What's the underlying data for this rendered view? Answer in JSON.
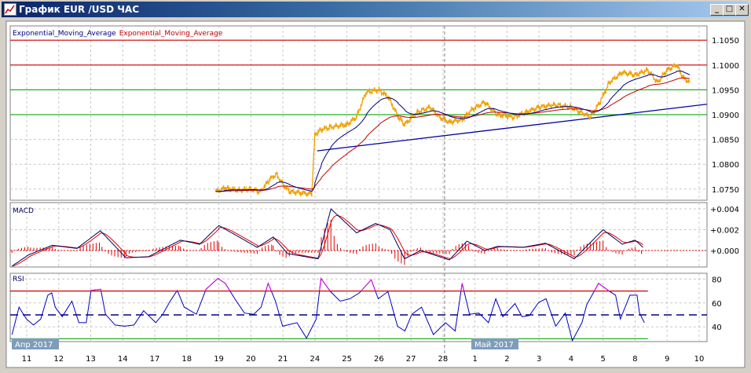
{
  "window": {
    "title": "График EUR /USD  ЧАС",
    "minimize_icon": "minimize-icon",
    "maximize_icon": "maximize-icon",
    "close_icon": "close-icon",
    "minimize_glyph": "_",
    "maximize_glyph": "□",
    "close_glyph": "✕"
  },
  "legend": {
    "ema_fast": "Exponential_Moving_Average",
    "ema_slow": "Exponential_Moving_Average"
  },
  "colors": {
    "price": "#f0a000",
    "ema_fast": "#000080",
    "ema_slow": "#c00000",
    "resist": "#d00000",
    "support": "#20b020",
    "trend": "#0000a0",
    "rsi": "#0000c0",
    "rsi_over": "#e000e0",
    "macd": "#000060",
    "signal": "#e00000",
    "hist": "#e00000",
    "month_tag": "#7f9db9"
  },
  "chart_data": [
    {
      "type": "line",
      "title": "EUR/USD H1",
      "x_labels": [
        "11",
        "12",
        "13",
        "14",
        "17",
        "18",
        "19",
        "20",
        "21",
        "24",
        "25",
        "26",
        "27",
        "28",
        "1",
        "2",
        "3",
        "4",
        "5",
        "8",
        "9",
        "10"
      ],
      "month_tags": [
        {
          "label": "Апр 2017",
          "at": -0.5
        },
        {
          "label": "Май 2017",
          "at": 14
        }
      ],
      "y_ticks": [
        "1.1050",
        "1.1000",
        "1.0950",
        "1.0900",
        "1.0850",
        "1.0800",
        "1.0750"
      ],
      "y_tick_values": [
        1.105,
        1.1,
        1.095,
        1.09,
        1.085,
        1.08,
        1.075
      ],
      "ylim": [
        1.0735,
        1.1085
      ],
      "horizontal_levels": [
        {
          "value": 1.105,
          "kind": "resistance"
        },
        {
          "value": 1.1,
          "kind": "resistance"
        },
        {
          "value": 1.095,
          "kind": "support"
        },
        {
          "value": 1.09,
          "kind": "support"
        }
      ],
      "trendline": [
        [
          9.07,
          1.0827
        ],
        [
          21.24,
          1.0921
        ]
      ],
      "price": [
        [
          5.9,
          1.0745
        ],
        [
          6.2,
          1.0752
        ],
        [
          6.6,
          1.0748
        ],
        [
          7.0,
          1.075
        ],
        [
          7.3,
          1.0745
        ],
        [
          7.6,
          1.077
        ],
        [
          7.8,
          1.078
        ],
        [
          8.0,
          1.076
        ],
        [
          8.2,
          1.0745
        ],
        [
          8.9,
          1.074
        ],
        [
          9.0,
          1.086
        ],
        [
          9.2,
          1.087
        ],
        [
          9.5,
          1.0875
        ],
        [
          10.0,
          1.088
        ],
        [
          10.3,
          1.0895
        ],
        [
          10.6,
          1.0945
        ],
        [
          11.0,
          1.095
        ],
        [
          11.3,
          1.0935
        ],
        [
          11.6,
          1.0895
        ],
        [
          11.8,
          1.088
        ],
        [
          12.2,
          1.0905
        ],
        [
          12.6,
          1.0915
        ],
        [
          12.9,
          1.0895
        ],
        [
          13.2,
          1.0885
        ],
        [
          13.6,
          1.089
        ],
        [
          13.9,
          1.091
        ],
        [
          14.3,
          1.0925
        ],
        [
          14.7,
          1.09
        ],
        [
          15.2,
          1.0895
        ],
        [
          15.6,
          1.0905
        ],
        [
          16.0,
          1.0915
        ],
        [
          16.5,
          1.092
        ],
        [
          17.0,
          1.0915
        ],
        [
          17.3,
          1.0905
        ],
        [
          17.6,
          1.0895
        ],
        [
          17.9,
          1.0925
        ],
        [
          18.2,
          1.0965
        ],
        [
          18.6,
          1.0985
        ],
        [
          19.0,
          1.098
        ],
        [
          19.4,
          1.099
        ],
        [
          19.7,
          1.0965
        ],
        [
          20.0,
          1.099
        ],
        [
          20.3,
          1.1
        ],
        [
          20.5,
          1.0975
        ],
        [
          20.7,
          1.0965
        ]
      ]
    },
    {
      "type": "line",
      "title": "MACD",
      "y_ticks": [
        "+0.004",
        "+0.002",
        "+0.000"
      ],
      "y_tick_values": [
        0.004,
        0.002,
        0.0
      ],
      "macd": [
        [
          -0.46,
          -0.0015
        ],
        [
          0.07,
          -0.0004
        ],
        [
          0.8,
          0.0005
        ],
        [
          1.57,
          0.0002
        ],
        [
          2.3,
          0.0019
        ],
        [
          3.1,
          -0.0007
        ],
        [
          3.8,
          -0.0006
        ],
        [
          4.8,
          0.001
        ],
        [
          5.4,
          0.0006
        ],
        [
          6.0,
          0.0024
        ],
        [
          7.2,
          0.0003
        ],
        [
          7.7,
          0.0013
        ],
        [
          8.15,
          -0.0003
        ],
        [
          9.1,
          -0.0008
        ],
        [
          9.5,
          0.004
        ],
        [
          10.3,
          0.0017
        ],
        [
          10.9,
          0.0026
        ],
        [
          11.35,
          0.002
        ],
        [
          11.8,
          -0.0008
        ],
        [
          12.3,
          0.0
        ],
        [
          13.2,
          -0.0009
        ],
        [
          13.75,
          0.0009
        ],
        [
          14.3,
          0.0
        ],
        [
          14.7,
          0.0004
        ],
        [
          15.5,
          0.0003
        ],
        [
          16.2,
          0.0007
        ],
        [
          17.1,
          -0.0008
        ],
        [
          18.0,
          0.002
        ],
        [
          18.6,
          0.0006
        ],
        [
          19.0,
          0.001
        ],
        [
          19.25,
          0.0003
        ]
      ]
    },
    {
      "type": "line",
      "title": "RSI",
      "y_ticks": [
        "80",
        "60",
        "40"
      ],
      "y_tick_values": [
        80,
        60,
        40
      ],
      "levels": [
        70,
        50,
        30
      ],
      "rsi": [
        [
          -0.46,
          35
        ],
        [
          -0.24,
          55
        ],
        [
          -0.01,
          48
        ],
        [
          0.21,
          40
        ],
        [
          0.44,
          48
        ],
        [
          0.66,
          65
        ],
        [
          0.78,
          70
        ],
        [
          0.89,
          55
        ],
        [
          1.11,
          50
        ],
        [
          1.41,
          60
        ],
        [
          1.63,
          45
        ],
        [
          1.86,
          42
        ],
        [
          2.01,
          72
        ],
        [
          2.31,
          70
        ],
        [
          2.46,
          52
        ],
        [
          2.76,
          40
        ],
        [
          3.06,
          42
        ],
        [
          3.35,
          40
        ],
        [
          3.65,
          55
        ],
        [
          4.03,
          42
        ],
        [
          4.25,
          52
        ],
        [
          4.48,
          60
        ],
        [
          4.7,
          72
        ],
        [
          4.92,
          55
        ],
        [
          5.3,
          52
        ],
        [
          5.6,
          70
        ],
        [
          5.97,
          82
        ],
        [
          6.2,
          75
        ],
        [
          6.5,
          65
        ],
        [
          6.8,
          50
        ],
        [
          7.09,
          52
        ],
        [
          7.32,
          55
        ],
        [
          7.54,
          78
        ],
        [
          7.77,
          60
        ],
        [
          7.99,
          42
        ],
        [
          8.44,
          42
        ],
        [
          8.74,
          32
        ],
        [
          9.04,
          45
        ],
        [
          9.19,
          82
        ],
        [
          9.49,
          68
        ],
        [
          9.79,
          63
        ],
        [
          10.09,
          62
        ],
        [
          10.39,
          70
        ],
        [
          10.76,
          78
        ],
        [
          10.98,
          65
        ],
        [
          11.28,
          68
        ],
        [
          11.58,
          42
        ],
        [
          11.81,
          35
        ],
        [
          12.03,
          52
        ],
        [
          12.33,
          55
        ],
        [
          12.7,
          35
        ],
        [
          13.08,
          42
        ],
        [
          13.38,
          38
        ],
        [
          13.6,
          75
        ],
        [
          13.83,
          52
        ],
        [
          14.12,
          50
        ],
        [
          14.42,
          45
        ],
        [
          14.65,
          62
        ],
        [
          14.87,
          50
        ],
        [
          15.25,
          58
        ],
        [
          15.47,
          50
        ],
        [
          15.7,
          48
        ],
        [
          15.99,
          62
        ],
        [
          16.22,
          62
        ],
        [
          16.52,
          42
        ],
        [
          16.82,
          50
        ],
        [
          17.04,
          30
        ],
        [
          17.34,
          42
        ],
        [
          17.49,
          60
        ],
        [
          17.86,
          75
        ],
        [
          18.16,
          72
        ],
        [
          18.39,
          65
        ],
        [
          18.54,
          48
        ],
        [
          18.84,
          65
        ],
        [
          19.06,
          68
        ],
        [
          19.14,
          50
        ],
        [
          19.29,
          45
        ]
      ]
    }
  ]
}
